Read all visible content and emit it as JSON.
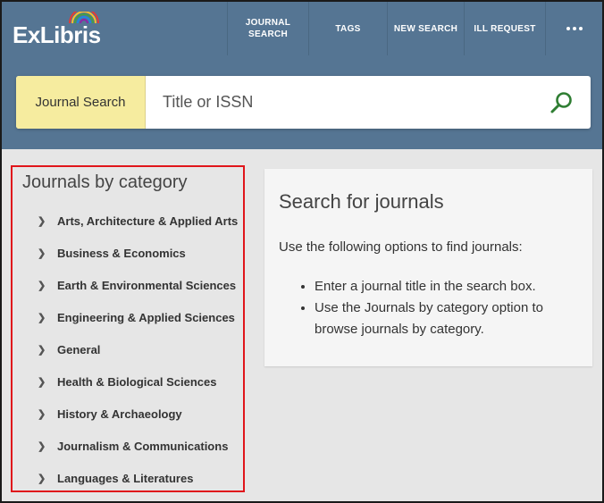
{
  "brand": {
    "logo_text": "ExLibris"
  },
  "nav": {
    "journal_search": "JOURNAL\nSEARCH",
    "tags": "TAGS",
    "new_search": "NEW SEARCH",
    "ill_request": "ILL REQUEST",
    "more_icon": "more-dots-icon"
  },
  "search": {
    "scope_label": "Journal Search",
    "placeholder": "Title or ISSN",
    "value": "",
    "button_icon": "search-icon"
  },
  "categories": {
    "title": "Journals by category",
    "items": [
      {
        "label": "Arts, Architecture & Applied Arts"
      },
      {
        "label": "Business & Economics"
      },
      {
        "label": "Earth & Environmental Sciences"
      },
      {
        "label": "Engineering & Applied Sciences"
      },
      {
        "label": "General"
      },
      {
        "label": "Health & Biological Sciences"
      },
      {
        "label": "History & Archaeology"
      },
      {
        "label": "Journalism & Communications"
      },
      {
        "label": "Languages & Literatures"
      }
    ]
  },
  "info": {
    "title": "Search for journals",
    "intro": "Use the following options to find journals:",
    "bullets": [
      "Enter a journal title in the search box.",
      "Use the Journals by category option to browse journals by category."
    ]
  },
  "colors": {
    "header": "#557593",
    "scope_bg": "#f6ec9f",
    "highlight_border": "#e0151b",
    "search_icon": "#2e7d32"
  }
}
